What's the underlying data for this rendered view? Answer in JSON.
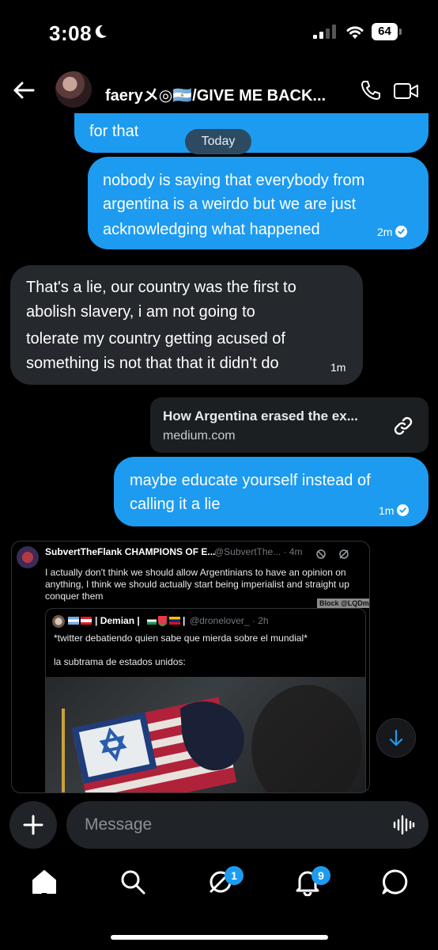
{
  "status_bar": {
    "time": "3:08",
    "battery": "64"
  },
  "header": {
    "contact_name": "faeryメ◎🇦🇷/GIVE ME BACK..."
  },
  "messages": {
    "partial_out": {
      "text": "for that"
    },
    "date_divider": "Today",
    "out_1": {
      "line1": "nobody is saying that everybody from",
      "line2": "argentina is a weirdo but we are just",
      "line3": "acknowledging what happened",
      "time": "2m"
    },
    "in_1": {
      "line1": "That's a lie, our country was the first to",
      "line2": "abolish slavery, i am not going to",
      "line3": "tolerate my country getting acused of",
      "line4": "something is not that that it didn't do",
      "time": "1m"
    },
    "link_card": {
      "title": "How Argentina erased the ex...",
      "domain": "medium.com"
    },
    "out_2": {
      "line1": "maybe educate yourself instead of",
      "line2": "calling it a lie",
      "time": "1m"
    }
  },
  "embedded_tweet": {
    "author_name": "SubvertTheFlank CHAMPIONS OF E...",
    "author_handle": "@SubvertThe... · 4m",
    "text": "I actually don't think we should allow Argentinians to have an opinion on anything, I think we should actually start being imperialist and straight up conquer them",
    "block_tag": "Block @LQDman",
    "quote": {
      "author_name": "| Demian |",
      "author_handle": "@dronelover_ · 2h",
      "text_line1": "*twitter debatiendo quien sabe que mierda sobre el mundial*",
      "text_line2": "la subtrama de estados unidos:"
    }
  },
  "composer": {
    "placeholder": "Message"
  },
  "tab_bar": {
    "communities_badge": "1",
    "notifications_badge": "9"
  },
  "colors": {
    "accent": "#1d9bf0",
    "incoming_bubble": "#25282c",
    "background": "#000000"
  },
  "icons": [
    "moon-icon",
    "signal-icon",
    "wifi-icon",
    "back-arrow-icon",
    "phone-icon",
    "video-icon",
    "check-icon",
    "link-icon",
    "scroll-down-icon",
    "plus-icon",
    "voice-icon",
    "home-icon",
    "search-icon",
    "communities-icon",
    "bell-icon",
    "messages-icon"
  ]
}
